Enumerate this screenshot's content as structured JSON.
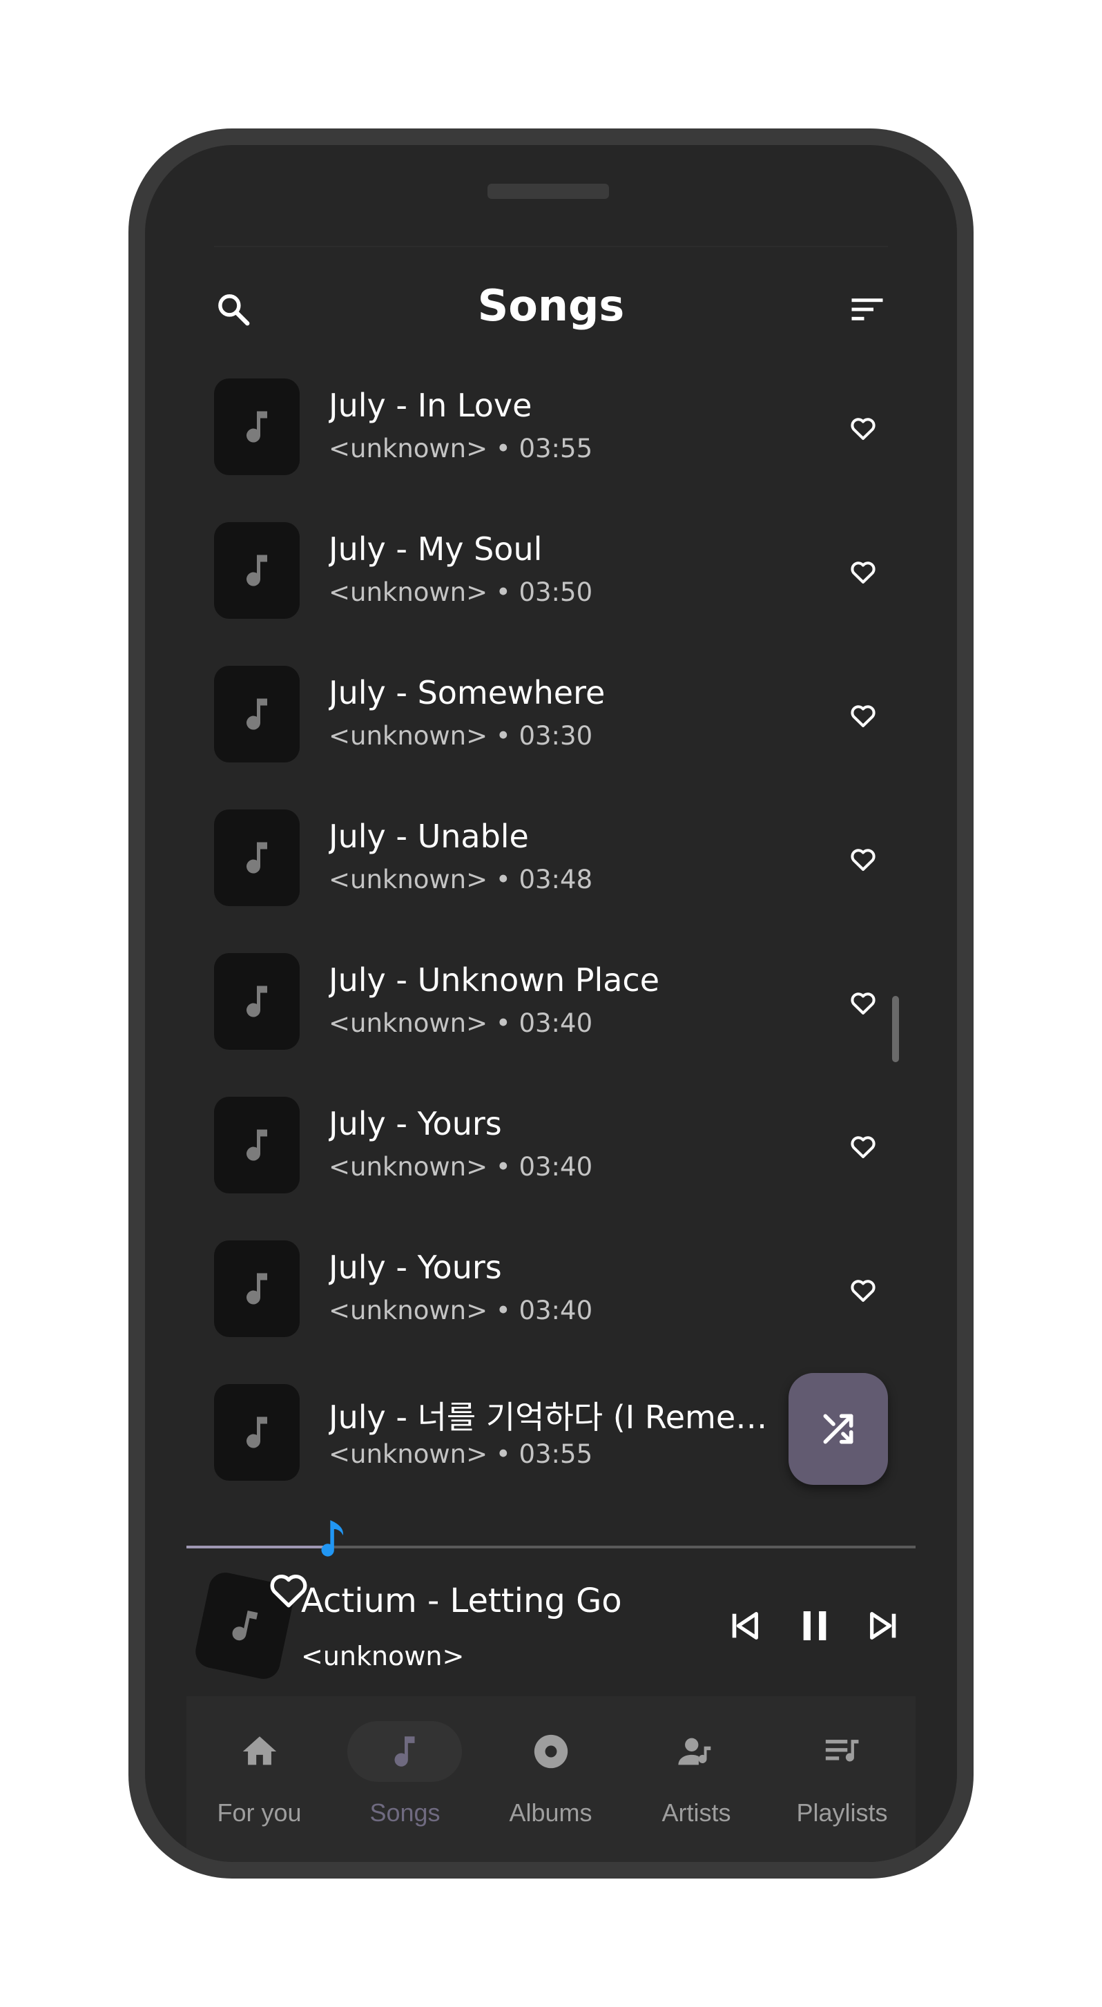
{
  "header": {
    "title": "Songs"
  },
  "songs": [
    {
      "title": "July - In Love",
      "subtitle": "<unknown> • 03:55"
    },
    {
      "title": "July - My Soul",
      "subtitle": "<unknown> • 03:50"
    },
    {
      "title": "July - Somewhere",
      "subtitle": "<unknown> • 03:30"
    },
    {
      "title": "July - Unable",
      "subtitle": "<unknown> • 03:48"
    },
    {
      "title": "July - Unknown Place",
      "subtitle": "<unknown> • 03:40"
    },
    {
      "title": "July - Yours",
      "subtitle": "<unknown> • 03:40"
    },
    {
      "title": "July - Yours",
      "subtitle": "<unknown> • 03:40"
    },
    {
      "title": "July - 너를 기억하다 (I Remem...",
      "subtitle": "<unknown> • 03:55"
    }
  ],
  "now_playing": {
    "title": "Actium - Letting Go",
    "artist": "<unknown>",
    "progress": 0.19
  },
  "nav": [
    {
      "label": "For you",
      "icon": "home-icon"
    },
    {
      "label": "Songs",
      "icon": "music-note-icon",
      "active": true
    },
    {
      "label": "Albums",
      "icon": "album-icon"
    },
    {
      "label": "Artists",
      "icon": "artist-icon"
    },
    {
      "label": "Playlists",
      "icon": "playlist-icon"
    }
  ],
  "colors": {
    "background": "#262626",
    "accent": "#625b71",
    "active_label": "#6f6a80",
    "progress_thumb": "#2196f3"
  }
}
